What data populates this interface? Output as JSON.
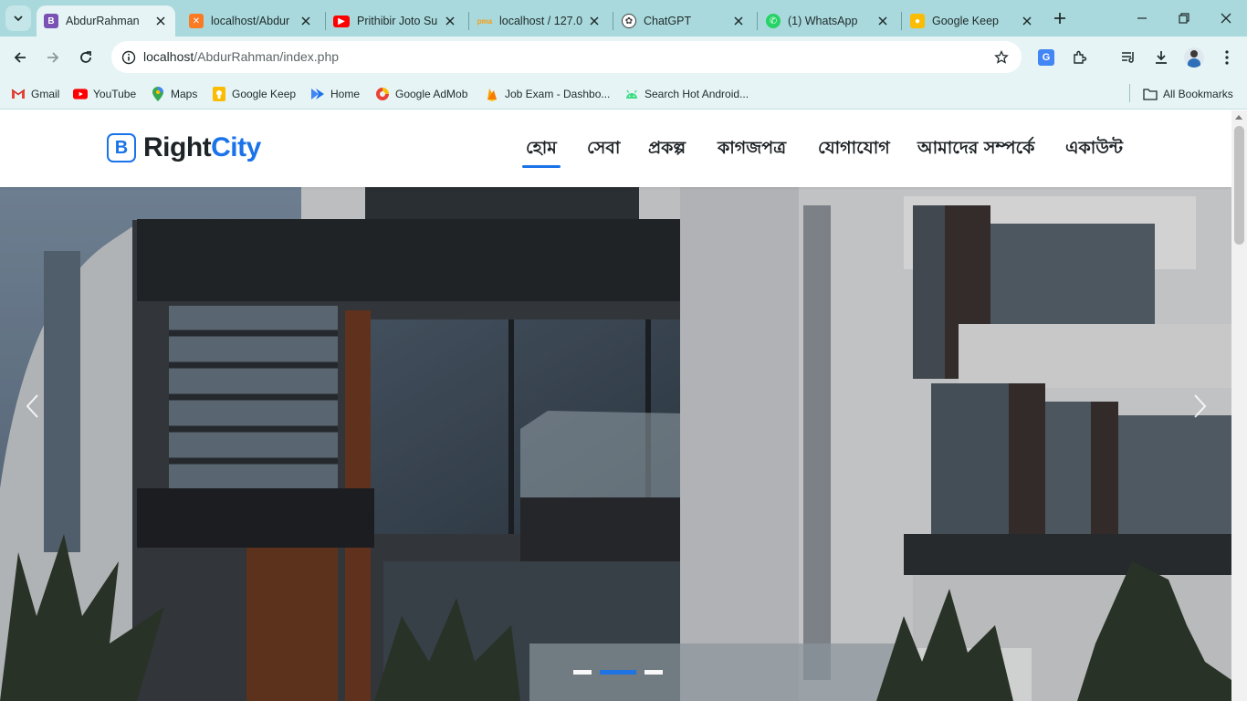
{
  "browser": {
    "tabs": [
      {
        "title": "AbdurRahman",
        "active": true,
        "favicon": "bootstrap-icon",
        "color": "#7952b3"
      },
      {
        "title": "localhost/Abdur",
        "active": false,
        "favicon": "xampp-icon",
        "color": "#fb7a24"
      },
      {
        "title": "Prithibir Joto Su",
        "active": false,
        "favicon": "youtube-icon",
        "color": "#ff0000"
      },
      {
        "title": "localhost / 127.0",
        "active": false,
        "favicon": "phpmyadmin-icon",
        "color": "#f89c0e"
      },
      {
        "title": "ChatGPT",
        "active": false,
        "favicon": "chatgpt-icon",
        "color": "#3a3a3a"
      },
      {
        "title": "(1) WhatsApp",
        "active": false,
        "favicon": "whatsapp-icon",
        "color": "#25d366"
      },
      {
        "title": "Google Keep",
        "active": false,
        "favicon": "google-keep-icon",
        "color": "#fbbc04"
      }
    ],
    "url_host": "localhost",
    "url_path": "/AbdurRahman/index.php",
    "bookmarks": [
      {
        "label": "Gmail",
        "icon": "gmail-icon"
      },
      {
        "label": "YouTube",
        "icon": "youtube-icon"
      },
      {
        "label": "Maps",
        "icon": "maps-icon"
      },
      {
        "label": "Google Keep",
        "icon": "google-keep-icon"
      },
      {
        "label": "Home",
        "icon": "home-icon"
      },
      {
        "label": "Google AdMob",
        "icon": "admob-icon"
      },
      {
        "label": "Job Exam - Dashbo...",
        "icon": "firebase-icon"
      },
      {
        "label": "Search Hot Android...",
        "icon": "android-icon"
      }
    ],
    "all_bookmarks_label": "All Bookmarks"
  },
  "site": {
    "logo_letter": "B",
    "logo_part1": "Right",
    "logo_part2": "City",
    "nav": [
      {
        "label": "হোম",
        "active": true
      },
      {
        "label": "সেবা",
        "active": false
      },
      {
        "label": "প্রকল্প",
        "active": false
      },
      {
        "label": "কাগজপত্র",
        "active": false
      },
      {
        "label": "যোগাযোগ",
        "active": false
      },
      {
        "label": "আমাদের সম্পর্কে",
        "active": false
      },
      {
        "label": "একাউন্ট",
        "active": false
      }
    ],
    "carousel": {
      "slides": 3,
      "active_index": 1
    }
  },
  "colors": {
    "chrome_frame": "#a9d9dc",
    "chrome_toolbar": "#e6f4f5",
    "brand_blue": "#1a73e8",
    "text_dark": "#1d2327"
  }
}
